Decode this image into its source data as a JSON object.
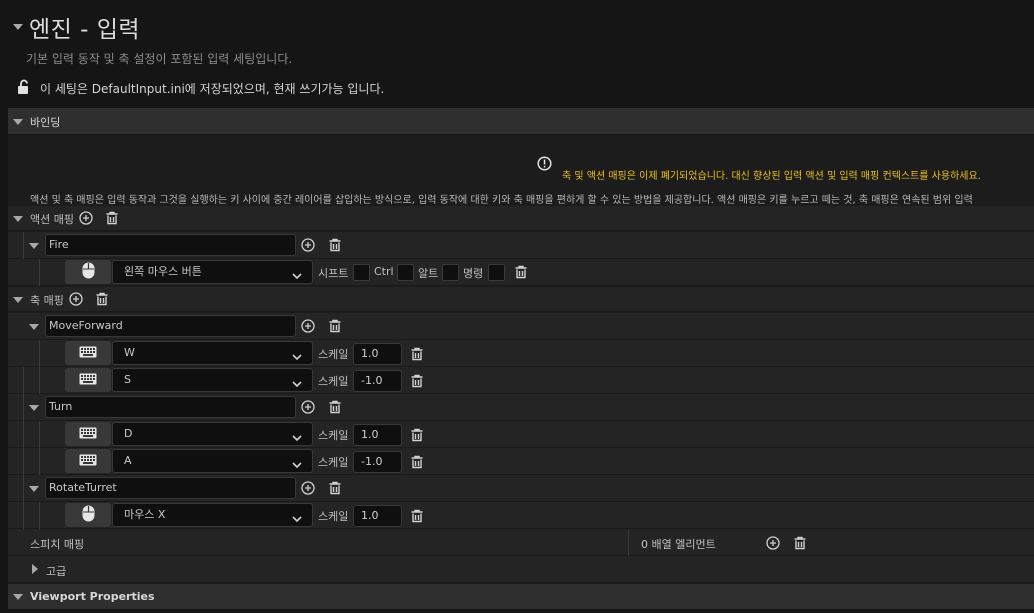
{
  "header": {
    "title": "엔진 - 입력",
    "description": "기본 입력 동작 및 축 설정이 포함된 입력 세팅입니다.",
    "config_notice": "이 세팅은 DefaultInput.ini에 저장되었으며, 현재 쓰기가능 입니다."
  },
  "bindings": {
    "section_label": "바인딩",
    "deprecation_warning": "축 및 액션 매핑은 이제 폐기되었습니다. 대신 향상된 입력 액션 및 입력 매핑 컨텍스트를 사용하세요.",
    "info_text": "액션 및 축 매핑은 입력 동작과 그것을 실행하는 키 사이에 중간 레이어를 삽입하는 방식으로, 입력 동작에 대한 키와 축 매핑을 편하게 할 수 있는 방법을 제공합니다. 액션 매핑은 키를 누르고 떼는 것, 축 매핑은 연속된 범위 입력",
    "action_mappings_label": "액션 매핑",
    "action_mappings": [
      {
        "name": "Fire",
        "key": "왼쪽 마우스 버튼",
        "device": "mouse",
        "modifiers": [
          "시프트",
          "Ctrl",
          "알트",
          "명령"
        ]
      }
    ],
    "axis_mappings_label": "축 매핑",
    "scale_label": "스케일",
    "axis_mappings": [
      {
        "name": "MoveForward",
        "keys": [
          {
            "key": "W",
            "device": "keyboard",
            "scale": "1.0"
          },
          {
            "key": "S",
            "device": "keyboard",
            "scale": "-1.0"
          }
        ]
      },
      {
        "name": "Turn",
        "keys": [
          {
            "key": "D",
            "device": "keyboard",
            "scale": "1.0"
          },
          {
            "key": "A",
            "device": "keyboard",
            "scale": "-1.0"
          }
        ]
      },
      {
        "name": "RotateTurret",
        "keys": [
          {
            "key": "마우스 X",
            "device": "mouse",
            "scale": "1.0"
          }
        ]
      }
    ],
    "speech_mappings_label": "스피치 매핑",
    "speech_mappings_count": "0 배열 엘리먼트",
    "advanced_label": "고급"
  },
  "viewport": {
    "section_label": "Viewport Properties"
  },
  "colors": {
    "warning": "#e8c020",
    "background": "#151515",
    "row": "#242424",
    "category": "#2f2f2f"
  }
}
